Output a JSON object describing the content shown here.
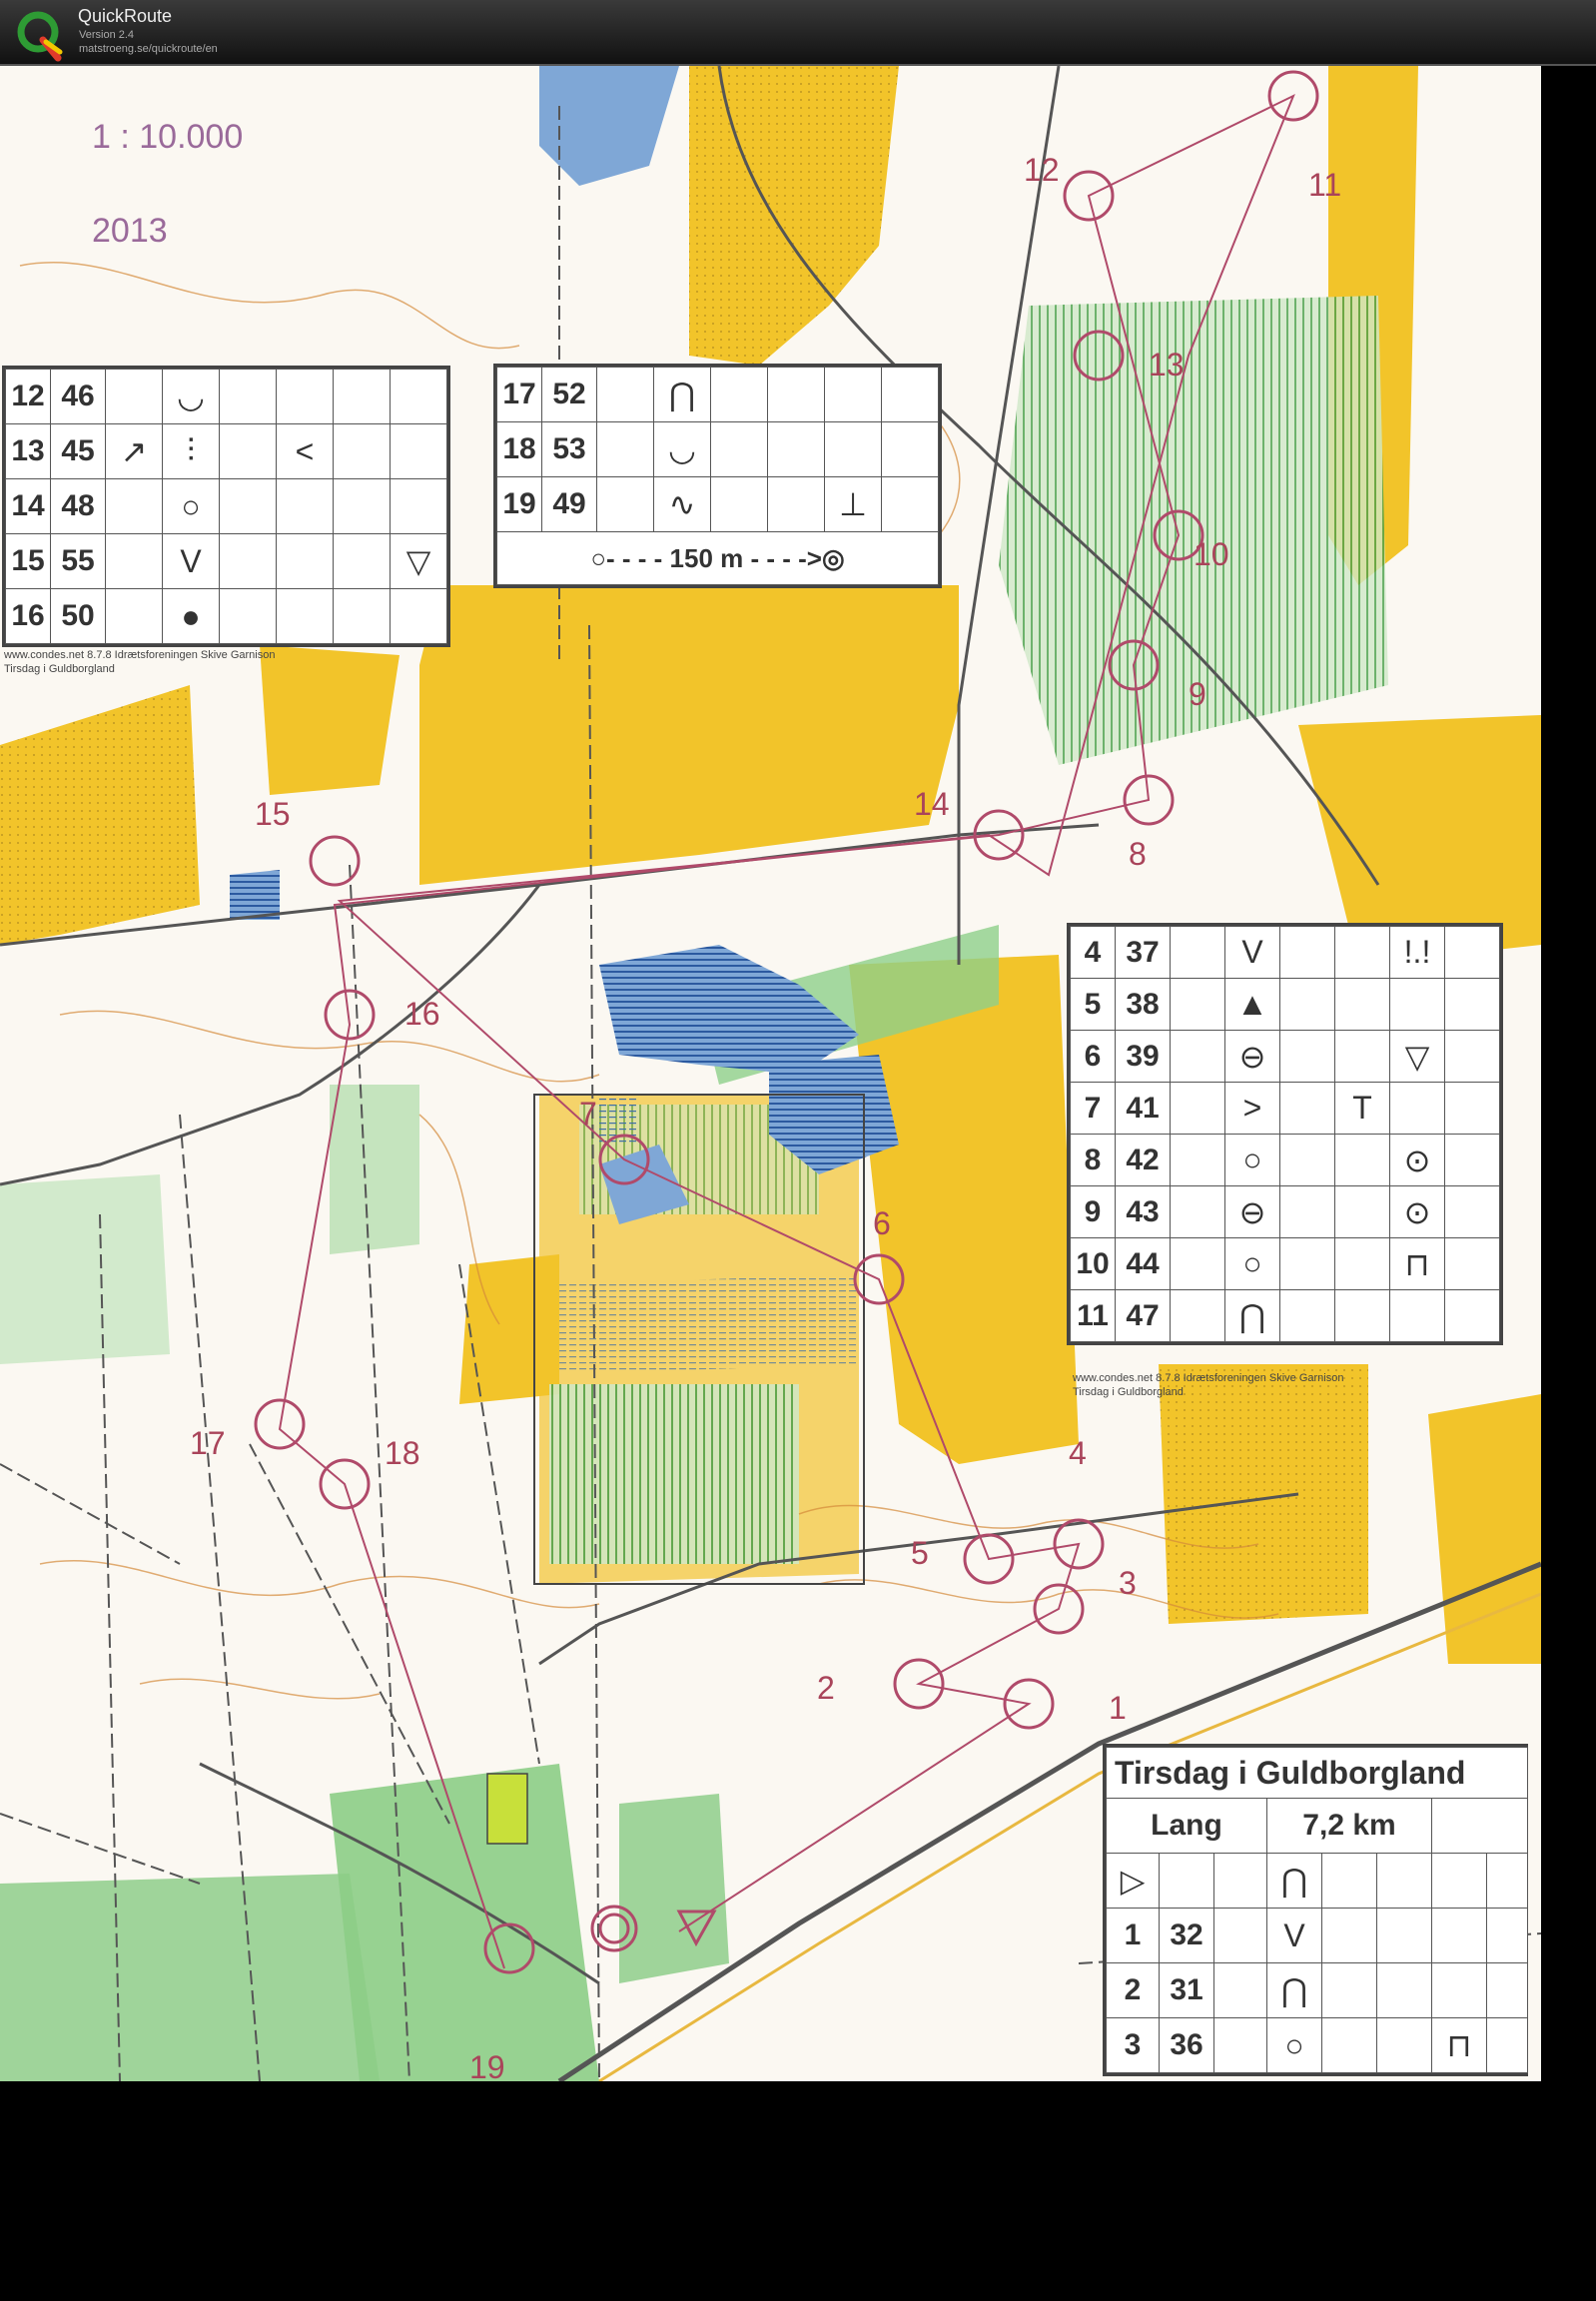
{
  "app": {
    "name": "QuickRoute",
    "version": "Version 2.4",
    "url": "matstroeng.se/quickroute/en"
  },
  "colors": {
    "open_land": "#f2c42a",
    "forest": "#fbf8f2",
    "green": "#7cc07a",
    "water": "#7fa7d6",
    "course": "#b04a6a",
    "contour": "#d48a3a"
  },
  "map": {
    "scale": "1 : 10.000",
    "year": "2013",
    "credit_line1": "www.condes.net 8.7.8 Idrætsforeningen Skive Garnison",
    "credit_line2": "Tirsdag i Guldborgland",
    "controls": [
      "1",
      "2",
      "3",
      "4",
      "5",
      "6",
      "7",
      "8",
      "9",
      "10",
      "11",
      "12",
      "13",
      "14",
      "15",
      "16",
      "17",
      "18",
      "19"
    ]
  },
  "desc_left": {
    "rows": [
      {
        "n": "12",
        "code": "46",
        "s1": "",
        "s2": "◡",
        "s3": "",
        "s4": "",
        "s5": "",
        "s6": ""
      },
      {
        "n": "13",
        "code": "45",
        "s1": "↗",
        "s2": "⫶",
        "s3": "",
        "s4": "<",
        "s5": "",
        "s6": ""
      },
      {
        "n": "14",
        "code": "48",
        "s1": "",
        "s2": "○",
        "s3": "",
        "s4": "",
        "s5": "",
        "s6": ""
      },
      {
        "n": "15",
        "code": "55",
        "s1": "",
        "s2": "V",
        "s3": "",
        "s4": "",
        "s5": "",
        "s6": "▽"
      },
      {
        "n": "16",
        "code": "50",
        "s1": "",
        "s2": "●",
        "s3": "",
        "s4": "",
        "s5": "",
        "s6": ""
      }
    ]
  },
  "desc_mid": {
    "rows": [
      {
        "n": "17",
        "code": "52",
        "s1": "",
        "s2": "⋂",
        "s3": "",
        "s4": "",
        "s5": "",
        "s6": ""
      },
      {
        "n": "18",
        "code": "53",
        "s1": "",
        "s2": "◡",
        "s3": "",
        "s4": "",
        "s5": "",
        "s6": ""
      },
      {
        "n": "19",
        "code": "49",
        "s1": "",
        "s2": "∿",
        "s3": "",
        "s4": "",
        "s5": "⊥",
        "s6": ""
      }
    ],
    "finish": "○- - - - 150 m - - - ->◎"
  },
  "desc_right": {
    "rows": [
      {
        "n": "4",
        "code": "37",
        "s1": "",
        "s2": "V",
        "s3": "",
        "s4": "",
        "s5": "!.!",
        "s6": ""
      },
      {
        "n": "5",
        "code": "38",
        "s1": "",
        "s2": "▲",
        "s3": "",
        "s4": "",
        "s5": "",
        "s6": ""
      },
      {
        "n": "6",
        "code": "39",
        "s1": "",
        "s2": "⊖",
        "s3": "",
        "s4": "",
        "s5": "▽",
        "s6": ""
      },
      {
        "n": "7",
        "code": "41",
        "s1": "",
        "s2": ">",
        "s3": "",
        "s4": "T",
        "s5": "",
        "s6": ""
      },
      {
        "n": "8",
        "code": "42",
        "s1": "",
        "s2": "○",
        "s3": "",
        "s4": "",
        "s5": "⊙",
        "s6": ""
      },
      {
        "n": "9",
        "code": "43",
        "s1": "",
        "s2": "⊖",
        "s3": "",
        "s4": "",
        "s5": "⊙",
        "s6": ""
      },
      {
        "n": "10",
        "code": "44",
        "s1": "",
        "s2": "○",
        "s3": "",
        "s4": "",
        "s5": "⊓",
        "s6": ""
      },
      {
        "n": "11",
        "code": "47",
        "s1": "",
        "s2": "⋂",
        "s3": "",
        "s4": "",
        "s5": "",
        "s6": ""
      }
    ]
  },
  "desc_main": {
    "title": "Tirsdag i Guldborgland",
    "course": "Lang",
    "length": "7,2 km",
    "start_symbol": "▷",
    "start_feature": "⋂",
    "rows": [
      {
        "n": "1",
        "code": "32",
        "s2": "V",
        "s5": ""
      },
      {
        "n": "2",
        "code": "31",
        "s2": "⋂",
        "s5": ""
      },
      {
        "n": "3",
        "code": "36",
        "s2": "○",
        "s5": "⊓"
      }
    ]
  }
}
